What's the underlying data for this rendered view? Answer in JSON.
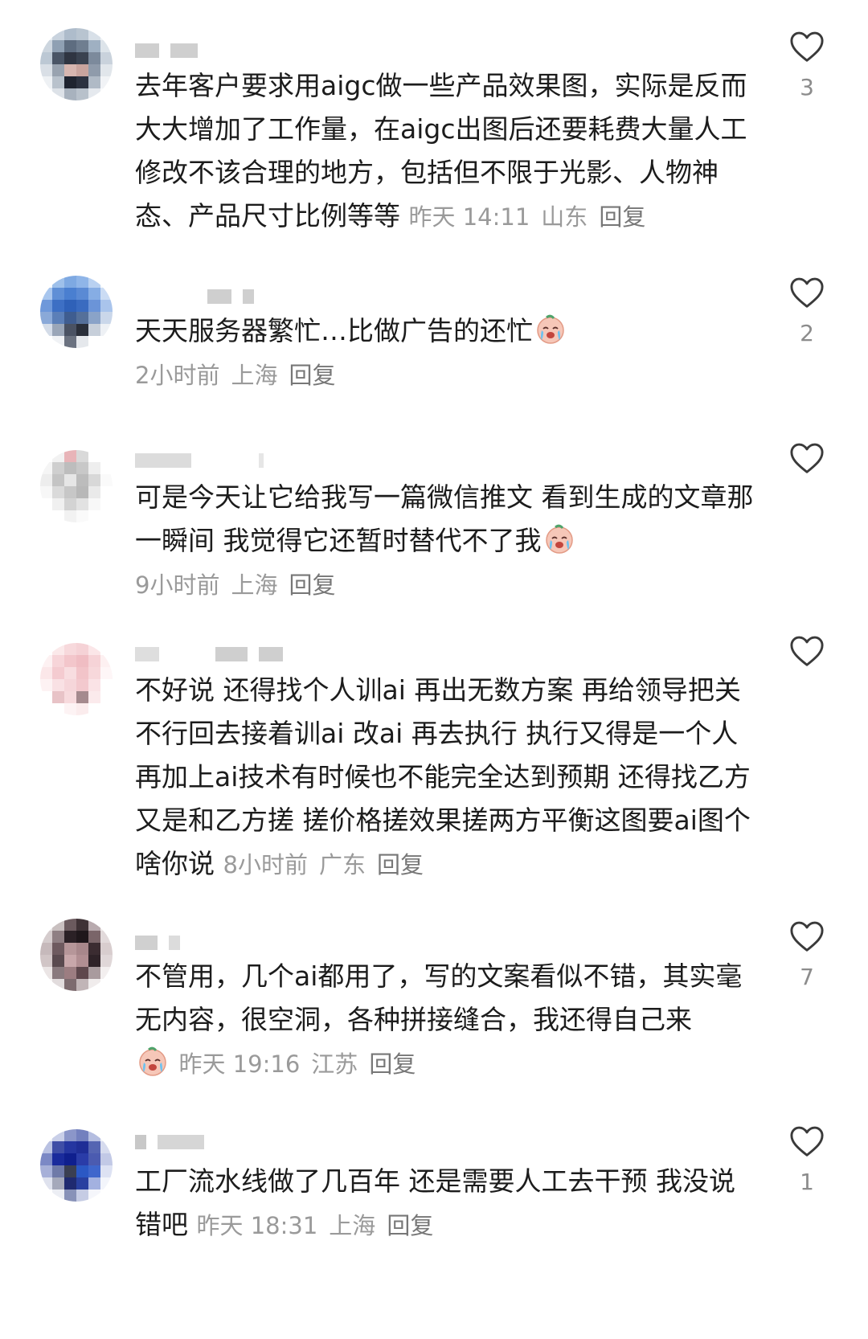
{
  "comments": [
    {
      "text": "去年客户要求用aigc做一些产品效果图，实际是反而大大增加了工作量，在aigc出图后还要耗费大量人工修改不该合理的地方，包括但不限于光影、人物神态、产品尺寸比例等等",
      "time": "昨天 14:11",
      "location": "山东",
      "reply": "回复",
      "likes": "3"
    },
    {
      "text": "天天服务器繁忙…比做广告的还忙",
      "time": "2小时前",
      "location": "上海",
      "reply": "回复",
      "likes": "2",
      "emoji": "crying-face"
    },
    {
      "text": "可是今天让它给我写一篇微信推文 看到生成的文章那一瞬间 我觉得它还暂时替代不了我",
      "time": "9小时前",
      "location": "上海",
      "reply": "回复",
      "likes": "",
      "emoji": "crying-face"
    },
    {
      "text": "不好说 还得找个人训ai 再出无数方案 再给领导把关 不行回去接着训ai 改ai 再去执行 执行又得是一个人 再加上ai技术有时候也不能完全达到预期 还得找乙方 又是和乙方搓 搓价格搓效果搓两方平衡这图要ai图个啥你说",
      "time": "8小时前",
      "location": "广东",
      "reply": "回复",
      "likes": ""
    },
    {
      "text": "不管用，几个ai都用了，写的文案看似不错，其实毫无内容，很空洞，各种拼接缝合，我还得自己来",
      "time": "昨天 19:16",
      "location": "江苏",
      "reply": "回复",
      "likes": "7",
      "emoji": "crying-face"
    },
    {
      "text": "工厂流水线做了几百年 还是需要人工去干预 我没说错吧",
      "time": "昨天 18:31",
      "location": "上海",
      "reply": "回复",
      "likes": "1"
    }
  ],
  "colors": {
    "text": "#1c1c1c",
    "meta": "#9a9a9a",
    "icon": "#3a3a3a"
  }
}
